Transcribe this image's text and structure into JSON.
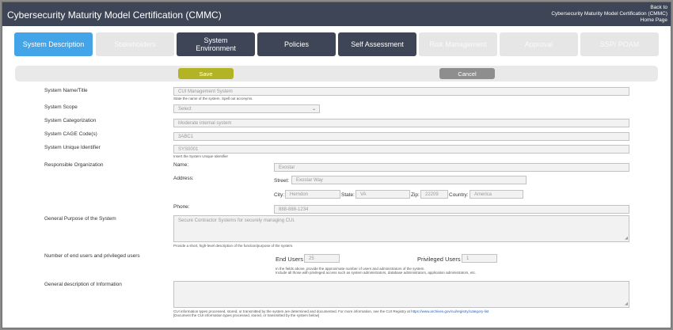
{
  "header": {
    "title": "Cybersecurity Maturity Model Certification (CMMC)",
    "back_line1": "Back to",
    "back_line2": "Cybersecurity Maturity Model Certification (CMMC)",
    "back_line3": "Home Page"
  },
  "tabs": [
    {
      "label": "System Description",
      "state": "active"
    },
    {
      "label": "Stakeholders",
      "state": "disabled"
    },
    {
      "label": "System Environment",
      "state": "dark"
    },
    {
      "label": "Policies",
      "state": "dark"
    },
    {
      "label": "Self Assessment",
      "state": "dark"
    },
    {
      "label": "Risk Management",
      "state": "disabled"
    },
    {
      "label": "Approval",
      "state": "disabled"
    },
    {
      "label": "SSP/ POAM",
      "state": "disabled"
    }
  ],
  "actions": {
    "save": "Save",
    "cancel": "Cancel"
  },
  "form": {
    "name_label": "System Name/Title",
    "name_value": "CUI Management System",
    "name_hint": "State the name of the system. Spell out acronyms.",
    "scope_label": "System Scope",
    "scope_value": "Select",
    "categorization_label": "System Categorization",
    "categorization_value": "Moderate internal system",
    "cage_label": "System CAGE Code(s)",
    "cage_value": "3ABC1",
    "uid_label": "System Unique Identifier",
    "uid_value": "SYS0001",
    "uid_hint": "Insert the System Unique Identifier",
    "org_label": "Responsible Organization",
    "org_name_label": "Name:",
    "org_name_value": "Exostar",
    "address_label": "Address:",
    "street_label": "Street:",
    "street_value": "Exostar Way",
    "city_label": "City:",
    "city_value": "Herndon",
    "state_label": "State:",
    "state_value": "VA",
    "zip_label": "Zip:",
    "zip_value": "22209",
    "country_label": "Country:",
    "country_value": "America",
    "phone_label": "Phone:",
    "phone_value": "888-888-1234",
    "purpose_label": "General Purpose of the System",
    "purpose_value": "Secure Contractor Systems for securely managing CUI.",
    "purpose_hint": "Provide a short, high-level description of the function/purpose of the system.",
    "users_label": "Number of end users and privileged users",
    "end_users_label": "End Users",
    "end_users_value": "25",
    "priv_users_label": "Privileged Users",
    "priv_users_value": "1",
    "users_hint1": "In the fields above, provide the approximate number of users and administrators of the system.",
    "users_hint2": "Include all those with privileged access such as system administrators, database administrators, application administrators, etc.",
    "info_label": "General description of Information",
    "info_value": "",
    "info_hint1": "CUI information types processed, stored, or transmitted by the system are determined and documented. For more information, see the CUI Registry at",
    "info_hint_link": "https://www.archives.gov/cui/registry/category-list",
    "info_hint2": "[Document the CUI information types processed, stored, or transmitted by the system below]"
  }
}
